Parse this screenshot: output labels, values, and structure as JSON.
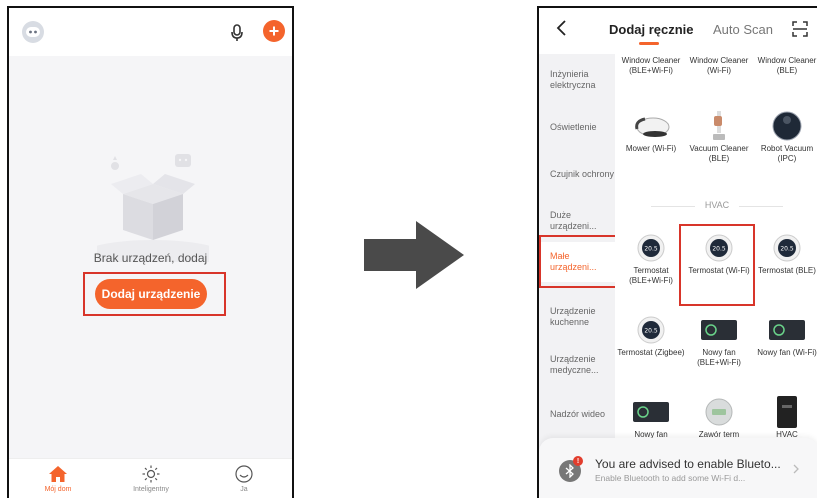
{
  "left_screen": {
    "empty_message": "Brak urządzeń, dodaj",
    "add_device_label": "Dodaj urządzenie",
    "tabs": [
      {
        "label": "Mój dom",
        "icon": "home-icon",
        "active": true
      },
      {
        "label": "Inteligentny",
        "icon": "sun-icon",
        "active": false
      },
      {
        "label": "Ja",
        "icon": "smiley-icon",
        "active": false
      }
    ]
  },
  "right_screen": {
    "header": {
      "active_tab": "Dodaj ręcznie",
      "other_tab": "Auto Scan"
    },
    "categories": [
      {
        "label": "Inżynieria elektryczna",
        "active": false
      },
      {
        "label": "Oświetlenie",
        "active": false
      },
      {
        "label": "Czujnik ochrony",
        "active": false
      },
      {
        "label": "Duże urządzeni...",
        "active": false
      },
      {
        "label": "Małe urządzeni...",
        "active": true
      },
      {
        "label": "Urządzenie kuchenne",
        "active": false
      },
      {
        "label": "Urządzenie medyczne...",
        "active": false
      },
      {
        "label": "Nadzór wideo",
        "active": false
      }
    ],
    "section_hvac": "HVAC",
    "devices": [
      {
        "name": "Window Cleaner (BLE+Wi-Fi)",
        "icon": "none"
      },
      {
        "name": "Window Cleaner (Wi-Fi)",
        "icon": "none"
      },
      {
        "name": "Window Cleaner (BLE)",
        "icon": "none"
      },
      {
        "name": "Mower (Wi-Fi)",
        "icon": "mower-icon"
      },
      {
        "name": "Vacuum Cleaner (BLE)",
        "icon": "vacuum-stick-icon"
      },
      {
        "name": "Robot Vacuum (IPC)",
        "icon": "robot-vacuum-icon"
      },
      {
        "name": "Termostat (BLE+Wi-Fi)",
        "icon": "thermostat-icon"
      },
      {
        "name": "Termostat (Wi-Fi)",
        "icon": "thermostat-icon"
      },
      {
        "name": "Termostat (BLE)",
        "icon": "thermostat-icon"
      },
      {
        "name": "Termostat (Zigbee)",
        "icon": "thermostat-icon"
      },
      {
        "name": "Nowy fan (BLE+Wi-Fi)",
        "icon": "fan-panel-icon"
      },
      {
        "name": "Nowy fan (Wi-Fi)",
        "icon": "fan-panel-icon"
      },
      {
        "name": "Nowy fan",
        "icon": "fan-panel-icon"
      },
      {
        "name": "Zawór term",
        "icon": "valve-icon"
      },
      {
        "name": "HVAC",
        "icon": "hvac-panel-icon"
      }
    ],
    "thermostat_display": "20.5",
    "bluetooth_banner": {
      "title": "You are advised to enable Blueto...",
      "subtitle": "Enable Bluetooth to add some Wi-Fi d...",
      "badge": "!"
    }
  },
  "colors": {
    "accent": "#f4642c",
    "highlight_box": "#d8352a",
    "arrow": "#4a4a4a"
  }
}
